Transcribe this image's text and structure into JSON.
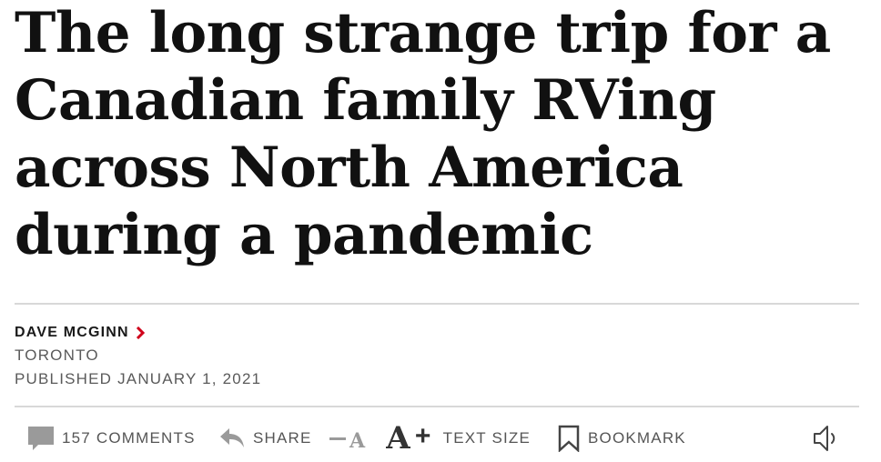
{
  "article": {
    "headline": "The long strange trip for a Canadian family RVing across North America during a pandemic",
    "author": "DAVE MCGINN",
    "location": "TORONTO",
    "published": "PUBLISHED JANUARY 1, 2021"
  },
  "toolbar": {
    "comments_label": "157 COMMENTS",
    "share_label": "SHARE",
    "text_size_small": "A",
    "text_size_large": "A",
    "text_size_plus": "+",
    "text_size_label": "TEXT SIZE",
    "bookmark_label": "BOOKMARK"
  },
  "icons": {
    "comments": "speech-bubble-icon",
    "share": "reply-arrow-icon",
    "bookmark": "bookmark-icon",
    "audio": "speaker-icon",
    "author_link": "chevron-right-icon"
  },
  "colors": {
    "accent": "#d0021b",
    "headline": "#111111",
    "muted": "#5a5a5a",
    "rule": "#d8d8d8"
  }
}
